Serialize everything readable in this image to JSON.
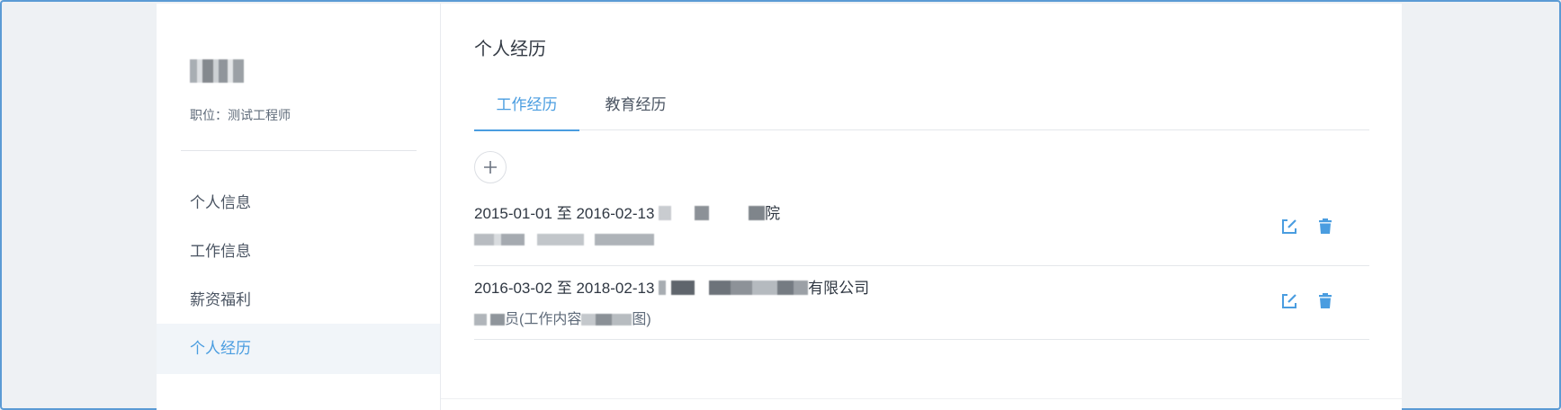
{
  "sidebar": {
    "position_text": "职位：测试工程师",
    "items": [
      {
        "label": "个人信息",
        "active": false
      },
      {
        "label": "工作信息",
        "active": false
      },
      {
        "label": "薪资福利",
        "active": false
      },
      {
        "label": "个人经历",
        "active": true
      }
    ]
  },
  "main": {
    "title": "个人经历",
    "tabs": [
      {
        "label": "工作经历",
        "active": true
      },
      {
        "label": "教育经历",
        "active": false
      }
    ],
    "add_icon": "plus-icon",
    "entries": [
      {
        "start": "2015-01-01",
        "sep": "至",
        "end": "2016-02-13",
        "org_suffix": "院",
        "desc_visible": ""
      },
      {
        "start": "2016-03-02",
        "sep": "至",
        "end": "2018-02-13",
        "org_suffix": "有限公司",
        "desc_prefix": "员(工作内容",
        "desc_suffix": "图)"
      }
    ],
    "action_icons": [
      "edit-icon",
      "trash-icon"
    ]
  },
  "colors": {
    "accent": "#4a9de0",
    "text": "#2f3742",
    "muted": "#5f6b7a",
    "sidebar_active_bg": "#f1f5f9"
  }
}
